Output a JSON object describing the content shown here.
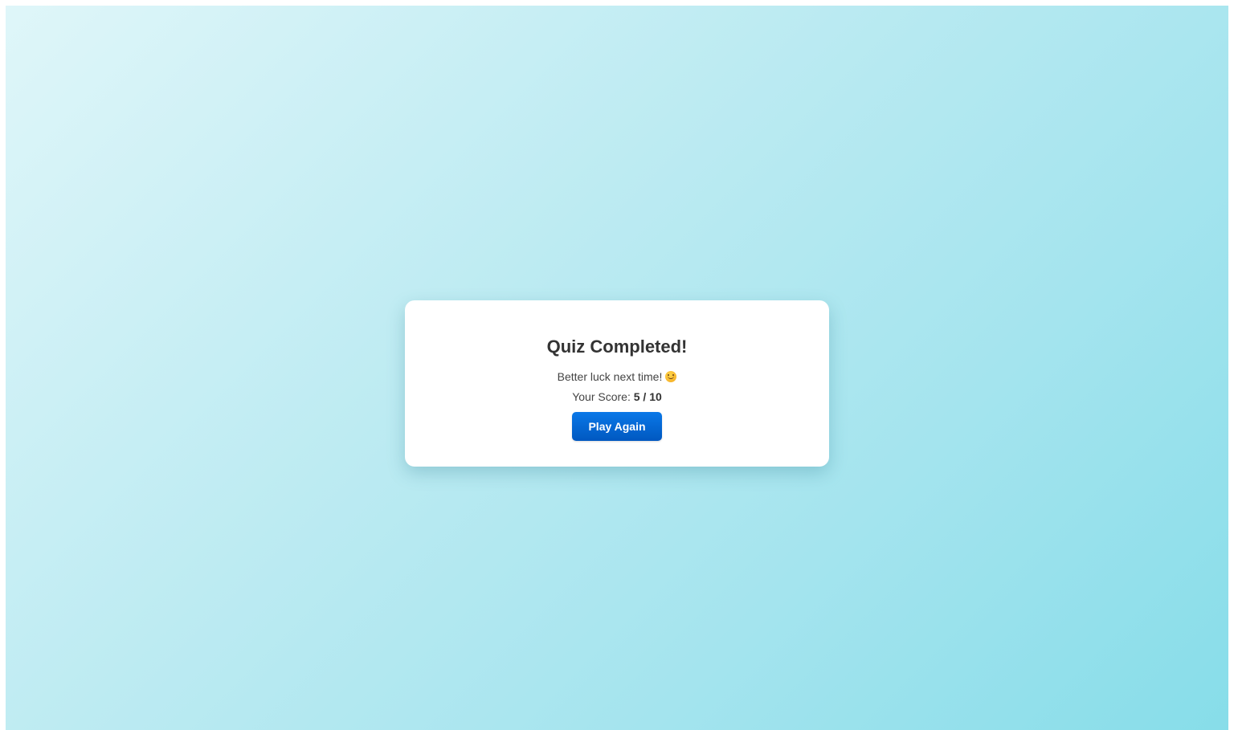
{
  "result": {
    "title": "Quiz Completed!",
    "message": "Better luck next time!",
    "emoji_icon": "smiling-face-icon",
    "score_label": "Your Score:",
    "score_value": "5 / 10",
    "score_correct": 5,
    "score_total": 10,
    "play_again_label": "Play Again"
  },
  "colors": {
    "background_start": "#dff6f9",
    "background_end": "#87dde9",
    "card": "#ffffff",
    "button": "#0a78e8",
    "button_text": "#ffffff",
    "title_text": "#333333"
  }
}
